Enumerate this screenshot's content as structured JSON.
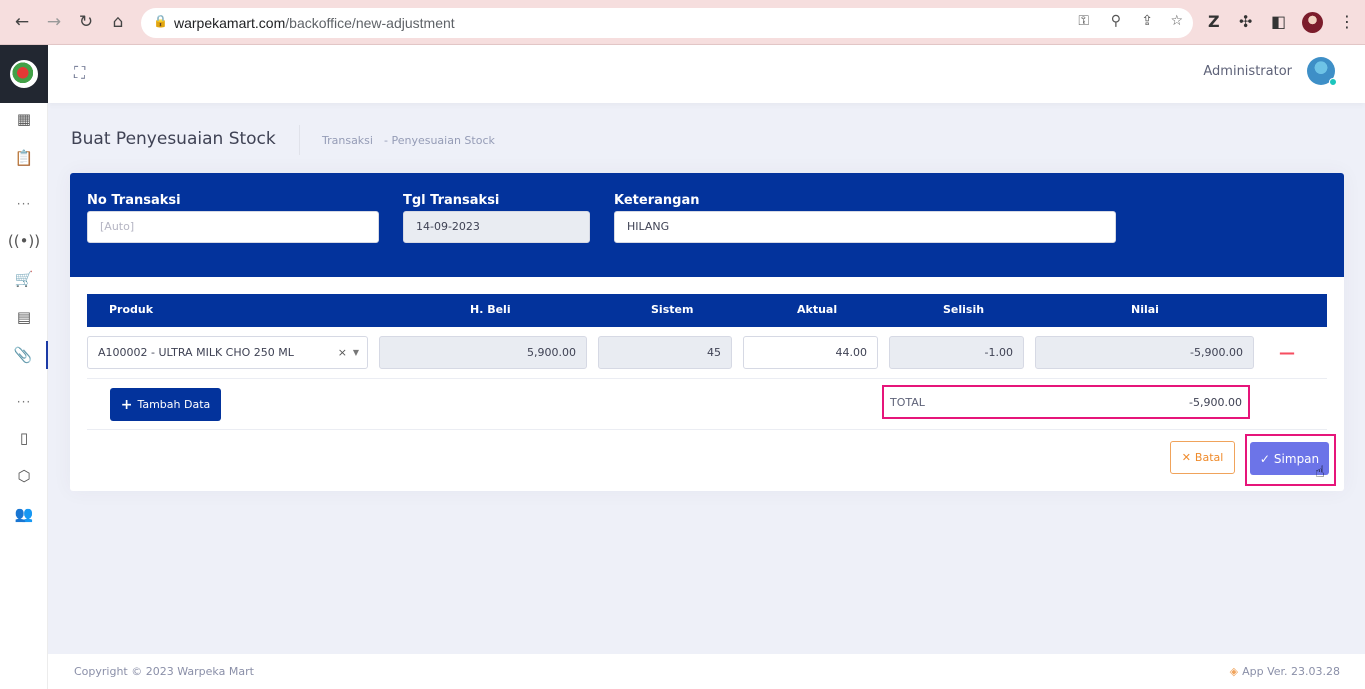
{
  "browser": {
    "url_host": "warpekamart.com",
    "url_path": "/backoffice/new-adjustment"
  },
  "header": {
    "user_name": "Administrator"
  },
  "page": {
    "title": "Buat Penyesuaian Stock",
    "breadcrumb": [
      "Transaksi",
      "-  Penyesuaian Stock"
    ]
  },
  "form": {
    "no_transaksi": {
      "label": "No Transaksi",
      "placeholder": "[Auto]"
    },
    "tgl_transaksi": {
      "label": "Tgl Transaksi",
      "value": "14-09-2023"
    },
    "keterangan": {
      "label": "Keterangan",
      "value": "HILANG"
    }
  },
  "table": {
    "columns": [
      "Produk",
      "H. Beli",
      "Sistem",
      "Aktual",
      "Selisih",
      "Nilai"
    ],
    "rows": [
      {
        "produk": "A100002 - ULTRA MILK CHO 250 ML",
        "h_beli": "5,900.00",
        "sistem": "45",
        "aktual": "44.00",
        "selisih": "-1.00",
        "nilai": "-5,900.00"
      }
    ]
  },
  "actions": {
    "add_label": "Tambah Data",
    "total_label": "TOTAL",
    "total_value": "-5,900.00",
    "cancel_label": "Batal",
    "save_label": "Simpan"
  },
  "footer": {
    "copyright": "Copyright © 2023 Warpeka Mart",
    "version": "App Ver. 23.03.28"
  },
  "colors": {
    "primary": "#03339c",
    "save": "#6c74e8",
    "highlight": "#e6157a",
    "cancel": "#ef8b2c"
  }
}
